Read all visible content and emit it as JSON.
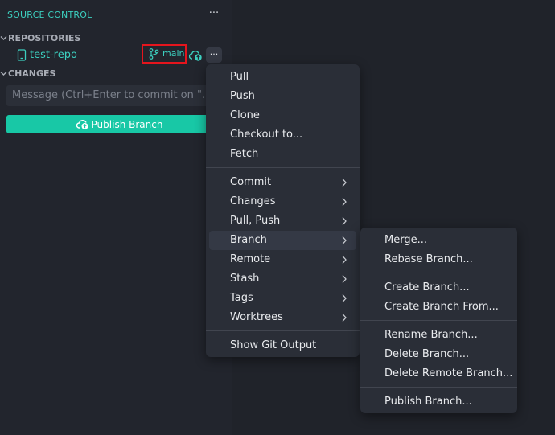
{
  "sidebar": {
    "title": "SOURCE CONTROL",
    "title_more": "···",
    "repositories_header": "REPOSITORIES",
    "repo": {
      "name": "test-repo",
      "branch": "main",
      "more": "···"
    },
    "changes_header": "CHANGES",
    "commit_placeholder": "Message (Ctrl+Enter to commit on \"...",
    "commit_tail": "'",
    "publish_label": "Publish Branch"
  },
  "menu": {
    "items": [
      "Pull",
      "Push",
      "Clone",
      "Checkout to...",
      "Fetch",
      "Commit",
      "Changes",
      "Pull, Push",
      "Branch",
      "Remote",
      "Stash",
      "Tags",
      "Worktrees",
      "Show Git Output"
    ]
  },
  "branch_submenu": {
    "items": [
      "Merge...",
      "Rebase Branch...",
      "Create Branch...",
      "Create Branch From...",
      "Rename Branch...",
      "Delete Branch...",
      "Delete Remote Branch...",
      "Publish Branch..."
    ]
  },
  "colors": {
    "accent": "#3ccfbf",
    "button": "#18c8a6",
    "highlight": "#e5151d"
  }
}
